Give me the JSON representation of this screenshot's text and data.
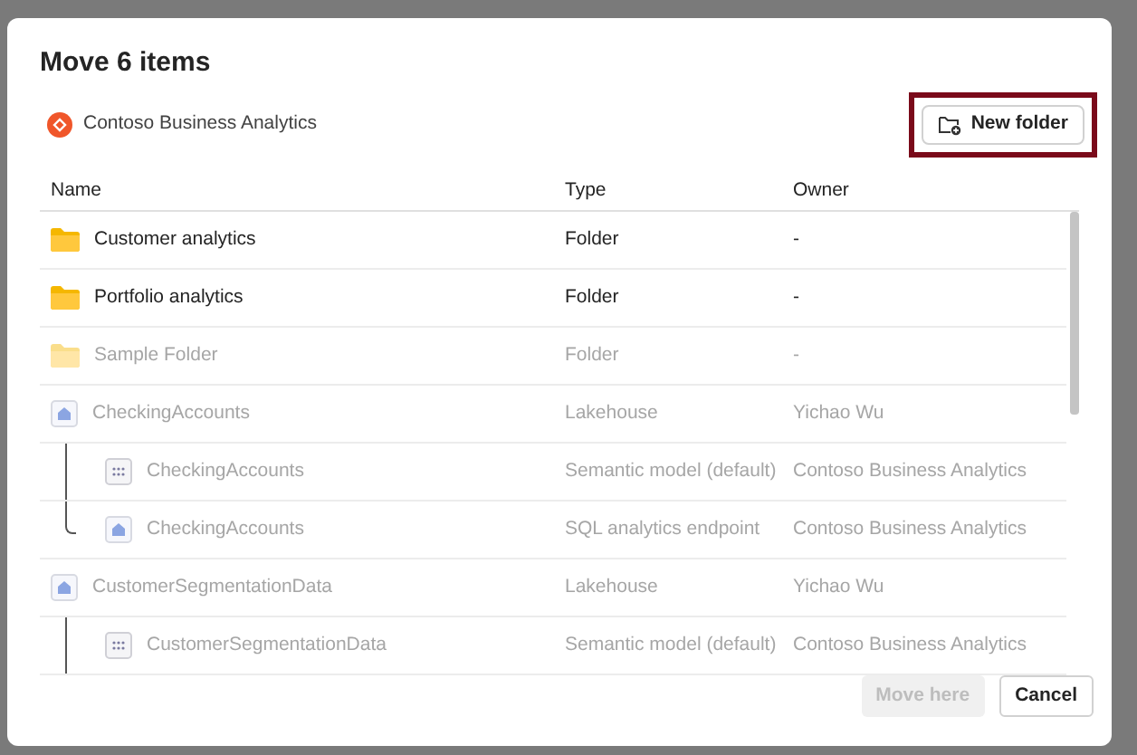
{
  "dialog": {
    "title": "Move 6 items",
    "workspace": "Contoso Business Analytics",
    "new_folder": {
      "label": "New folder",
      "highlighted": true
    },
    "columns": [
      "Name",
      "Type",
      "Owner"
    ],
    "rows": [
      {
        "kind": "folder",
        "name": "Customer analytics",
        "type": "Folder",
        "owner": "-",
        "disabled": false
      },
      {
        "kind": "folder",
        "name": "Portfolio analytics",
        "type": "Folder",
        "owner": "-",
        "disabled": false
      },
      {
        "kind": "folder",
        "name": "Sample Folder",
        "type": "Folder",
        "owner": "-",
        "disabled": true
      },
      {
        "kind": "lakehouse",
        "name": "CheckingAccounts",
        "type": "Lakehouse",
        "owner": "Yichao Wu",
        "disabled": true,
        "children": [
          {
            "kind": "semantic",
            "name": "CheckingAccounts",
            "type": "Semantic model (default)",
            "owner": "Contoso Business Analytics",
            "disabled": true
          },
          {
            "kind": "sql",
            "name": "CheckingAccounts",
            "type": "SQL analytics endpoint",
            "owner": "Contoso Business Analytics",
            "disabled": true
          }
        ]
      },
      {
        "kind": "lakehouse",
        "name": "CustomerSegmentationData",
        "type": "Lakehouse",
        "owner": "Yichao Wu",
        "disabled": true,
        "children": [
          {
            "kind": "semantic",
            "name": "CustomerSegmentationData",
            "type": "Semantic model (default)",
            "owner": "Contoso Business Analytics",
            "disabled": true
          }
        ]
      }
    ],
    "buttons": [
      {
        "label": "Move here",
        "disabled": true
      },
      {
        "label": "Cancel",
        "disabled": false
      }
    ]
  }
}
